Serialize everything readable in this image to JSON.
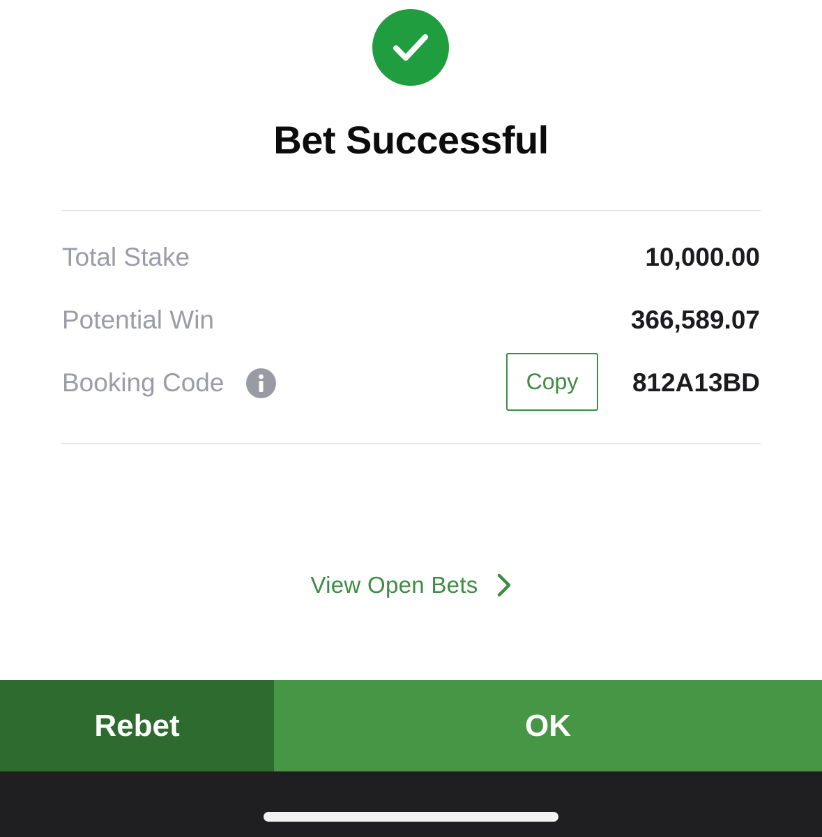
{
  "header": {
    "status_icon": "checkmark-icon",
    "title": "Bet Successful"
  },
  "summary": {
    "total_stake_label": "Total Stake",
    "total_stake_value": "10,000.00",
    "potential_win_label": "Potential Win",
    "potential_win_value": "366,589.07",
    "booking_code_label": "Booking Code",
    "booking_code_info_icon": "info-icon",
    "copy_label": "Copy",
    "booking_code_value": "812A13BD"
  },
  "links": {
    "view_open_bets": "View Open Bets",
    "view_open_bets_icon": "chevron-right-icon"
  },
  "actions": {
    "rebet_label": "Rebet",
    "ok_label": "OK"
  },
  "colors": {
    "success_green": "#1f9d3f",
    "link_green": "#3d8c43",
    "rebet_bg": "#2e6b2e",
    "ok_bg": "#469646",
    "label_gray": "#9c9ca7"
  }
}
